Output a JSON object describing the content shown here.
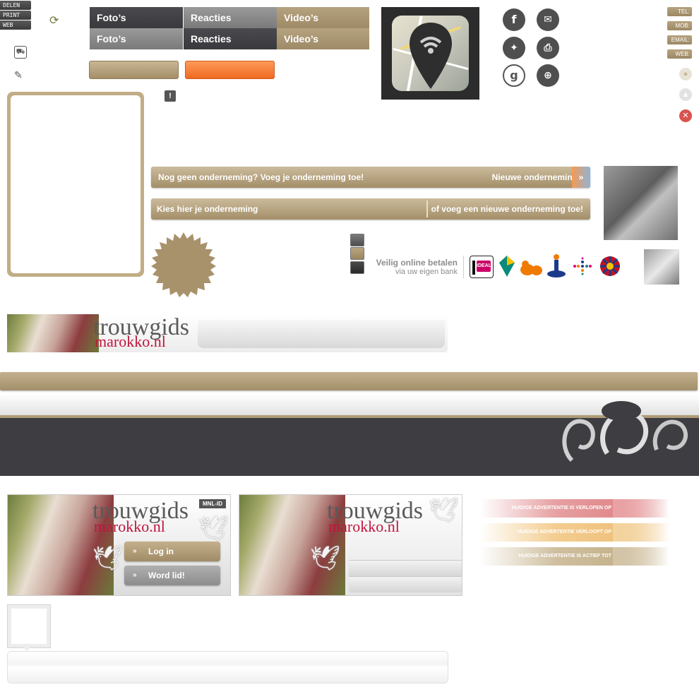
{
  "share_menu": {
    "share": "DELEN",
    "print": "PRINT",
    "web": "WEB"
  },
  "tabs_top": {
    "photos": "Foto’s",
    "reactions": "Reacties",
    "videos": "Video’s"
  },
  "tabs_bottom": {
    "photos": "Foto’s",
    "reactions": "Reacties",
    "videos": "Video’s"
  },
  "contact_tags": {
    "tel": "TEL:",
    "mob": "MOB:",
    "email": "EMAIL:",
    "web": "WEB:"
  },
  "banner_new_business": {
    "text": "Nog geen onderneming? Voeg je onderneming toe!",
    "link": "Nieuwe onderneming"
  },
  "banner_choose_business": {
    "choose": "Kies hier je onderneming",
    "add": "of voeg een nieuwe onderneming toe!"
  },
  "payment": {
    "title": "Veilig online betalen",
    "subtitle": "via uw eigen bank",
    "ideal_label": "iDEAL",
    "banks": [
      "abn-amro-icon",
      "ing-lion-icon",
      "rabobank-icon",
      "sns-icon",
      "fortis-icon"
    ]
  },
  "logo": {
    "line1": "trouwgids",
    "line2": "marokko.nl",
    "badge": "MNL-ID"
  },
  "login_panel": {
    "login": "Log in",
    "register": "Word lid!"
  },
  "status_bars": [
    {
      "label": "HUIDIGE ADVERTENTIE IS VERLOPEN OP",
      "color": "#e38d8f"
    },
    {
      "label": "HUIDIGE ADVERTENTIE VERLOOPT OP",
      "color": "#f2c98a"
    },
    {
      "label": "HUIDIGE ADVERTENTIE IS ACTIEF TOT",
      "color": "#cdbd9e"
    }
  ],
  "colors": {
    "tan": "#a7926d",
    "dark": "#3d3d42",
    "orange": "#f07a35",
    "grey": "#8a8a8a"
  }
}
